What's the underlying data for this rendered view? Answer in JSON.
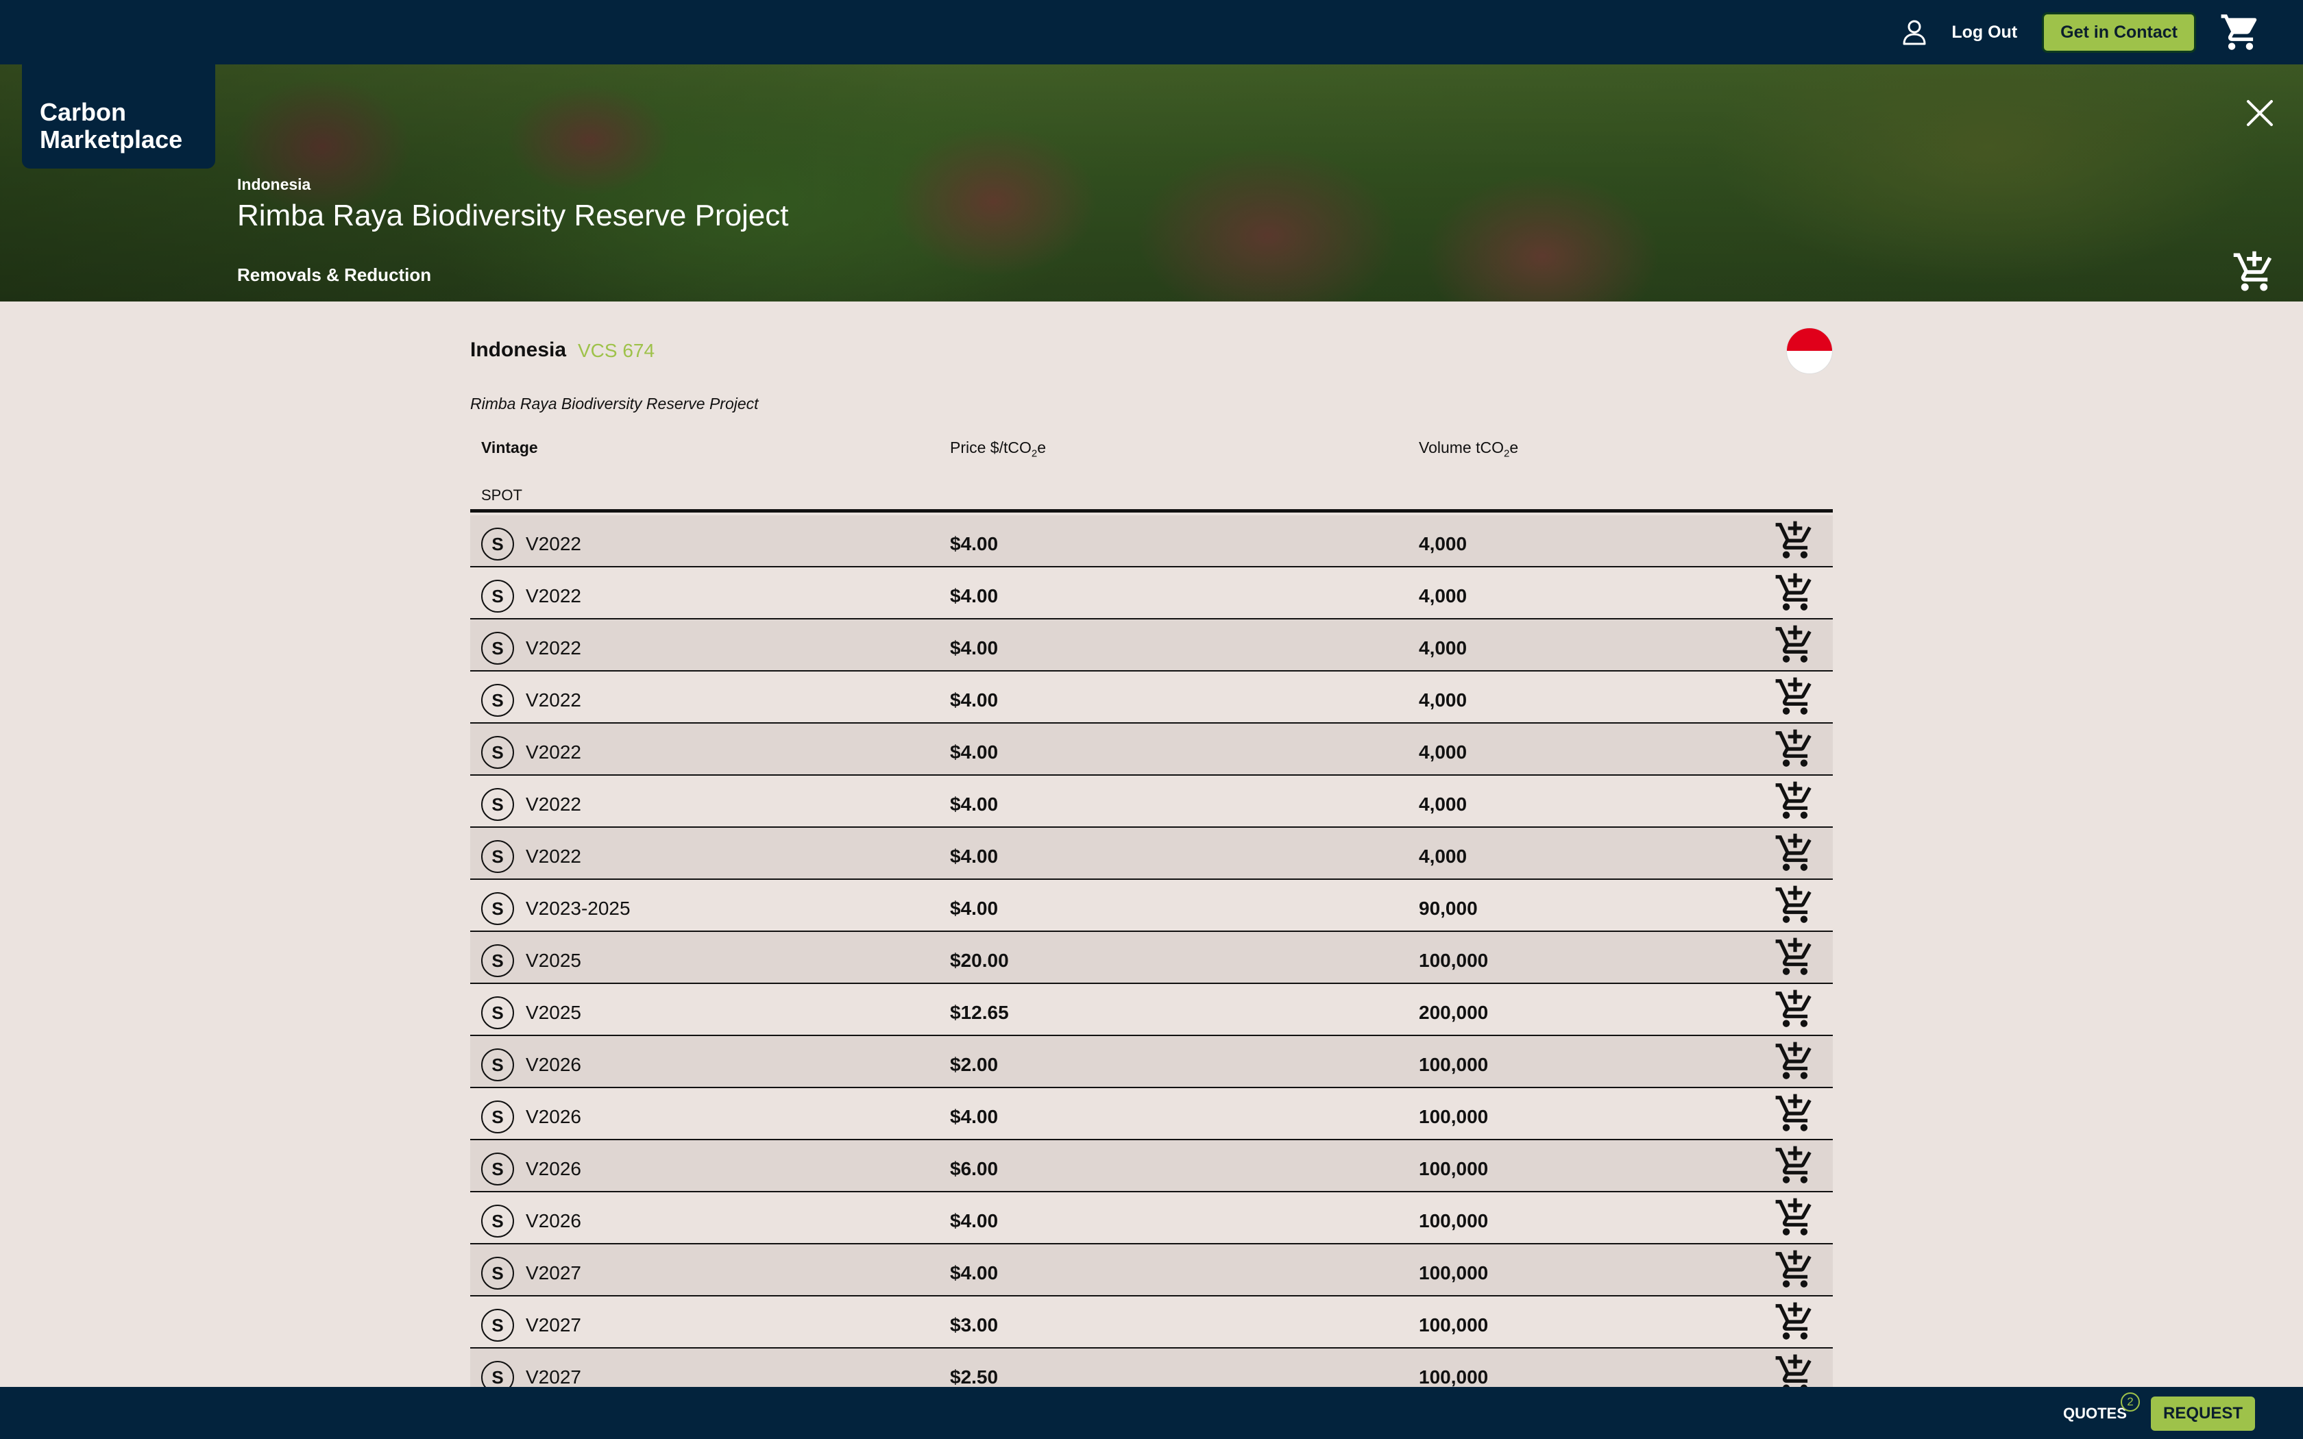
{
  "topbar": {
    "logout_label": "Log Out",
    "contact_label": "Get in Contact"
  },
  "brand": {
    "line1": "Carbon",
    "line2": "Marketplace"
  },
  "hero": {
    "country": "Indonesia",
    "title": "Rimba Raya Biodiversity Reserve Project",
    "category": "Removals & Reduction"
  },
  "project": {
    "country": "Indonesia",
    "code": "VCS 674",
    "subtitle": "Rimba Raya Biodiversity Reserve Project",
    "flag": {
      "top_color": "#e0001a",
      "bottom_color": "#ffffff"
    }
  },
  "table": {
    "headers": {
      "vintage": "Vintage",
      "price_prefix": "Price $/tCO",
      "price_sub": "2",
      "price_suffix": "e",
      "volume_prefix": "Volume tCO",
      "volume_sub": "2",
      "volume_suffix": "e"
    },
    "group_label": "SPOT",
    "badge": "S",
    "rows": [
      {
        "vintage": "V2022",
        "price": "$4.00",
        "volume": "4,000"
      },
      {
        "vintage": "V2022",
        "price": "$4.00",
        "volume": "4,000"
      },
      {
        "vintage": "V2022",
        "price": "$4.00",
        "volume": "4,000"
      },
      {
        "vintage": "V2022",
        "price": "$4.00",
        "volume": "4,000"
      },
      {
        "vintage": "V2022",
        "price": "$4.00",
        "volume": "4,000"
      },
      {
        "vintage": "V2022",
        "price": "$4.00",
        "volume": "4,000"
      },
      {
        "vintage": "V2022",
        "price": "$4.00",
        "volume": "4,000"
      },
      {
        "vintage": "V2023-2025",
        "price": "$4.00",
        "volume": "90,000"
      },
      {
        "vintage": "V2025",
        "price": "$20.00",
        "volume": "100,000"
      },
      {
        "vintage": "V2025",
        "price": "$12.65",
        "volume": "200,000"
      },
      {
        "vintage": "V2026",
        "price": "$2.00",
        "volume": "100,000"
      },
      {
        "vintage": "V2026",
        "price": "$4.00",
        "volume": "100,000"
      },
      {
        "vintage": "V2026",
        "price": "$6.00",
        "volume": "100,000"
      },
      {
        "vintage": "V2026",
        "price": "$4.00",
        "volume": "100,000"
      },
      {
        "vintage": "V2027",
        "price": "$4.00",
        "volume": "100,000"
      },
      {
        "vintage": "V2027",
        "price": "$3.00",
        "volume": "100,000"
      },
      {
        "vintage": "V2027",
        "price": "$2.50",
        "volume": "100,000"
      }
    ]
  },
  "bottombar": {
    "quotes_label": "QUOTES",
    "quotes_count": "2",
    "request_label": "REQUEST"
  },
  "colors": {
    "navy": "#03233d",
    "accent_green": "#9ec24a",
    "page_bg": "#ebe3df",
    "row_alt_bg": "#dfd6d2"
  },
  "icons": [
    "user-icon",
    "cart-icon",
    "close-icon",
    "add-to-cart-icon"
  ]
}
